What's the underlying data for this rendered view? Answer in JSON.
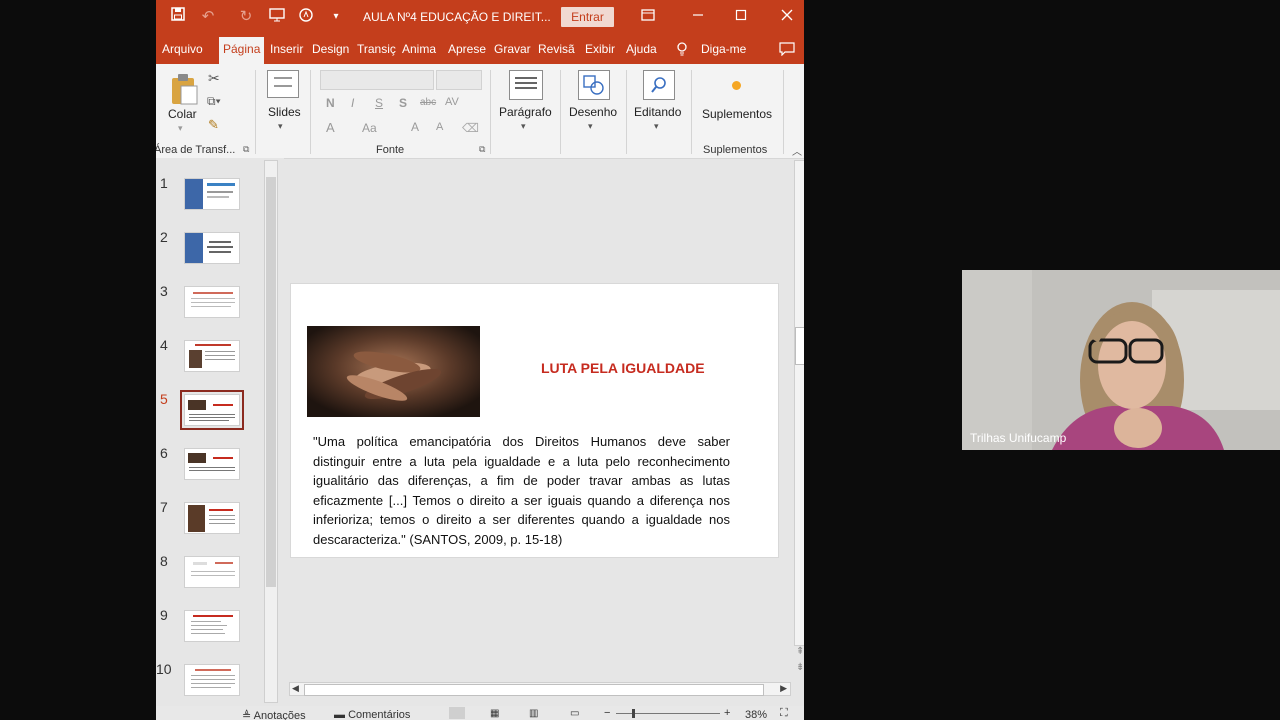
{
  "window": {
    "title": "AULA Nº4 EDUCAÇÃO E DIREIT...",
    "signin_label": "Entrar"
  },
  "tabs": [
    {
      "label": "Arquivo"
    },
    {
      "label": "Página"
    },
    {
      "label": "Inserir"
    },
    {
      "label": "Design"
    },
    {
      "label": "Transiç"
    },
    {
      "label": "Anima"
    },
    {
      "label": "Aprese"
    },
    {
      "label": "Gravar"
    },
    {
      "label": "Revisã"
    },
    {
      "label": "Exibir"
    },
    {
      "label": "Ajuda"
    },
    {
      "label": "Diga-me"
    }
  ],
  "ribbon": {
    "paste_label": "Colar",
    "clipboard_group": "Área de Transf...",
    "slides_label": "Slides",
    "font_group": "Fonte",
    "font_buttons": [
      "N",
      "I",
      "S",
      "S",
      "abc",
      "AV",
      "A",
      "Aa",
      "A",
      "A"
    ],
    "paragraph_label": "Parágrafo",
    "drawing_label": "Desenho",
    "editing_label": "Editando",
    "addins_label": "Suplementos",
    "addins_group": "Suplementos"
  },
  "thumbnails": [
    {
      "num": "1"
    },
    {
      "num": "2"
    },
    {
      "num": "3"
    },
    {
      "num": "4"
    },
    {
      "num": "5"
    },
    {
      "num": "6"
    },
    {
      "num": "7"
    },
    {
      "num": "8"
    },
    {
      "num": "9"
    },
    {
      "num": "10"
    }
  ],
  "slide": {
    "title": "LUTA PELA IGUALDADE",
    "quote": "\"Uma política emancipatória dos Direitos Humanos deve saber distinguir entre a luta pela igualdade e a luta pelo reconhecimento igualitário das diferenças, a fim de poder travar ambas as lutas eficazmente [...] Temos o direito a ser iguais quando a diferença nos inferioriza; temos o direito a ser diferentes quando a igualdade nos descaracteriza.\" (SANTOS, 2009, p. 15-18)"
  },
  "statusbar": {
    "notes_label": "Anotações",
    "comments_label": "Comentários",
    "zoom": "38%"
  },
  "webcam": {
    "name": "Trilhas Unifucamp"
  },
  "colors": {
    "accent": "#c43e1c",
    "title_red": "#c62b1f",
    "selected_border": "#8b2a1f"
  }
}
